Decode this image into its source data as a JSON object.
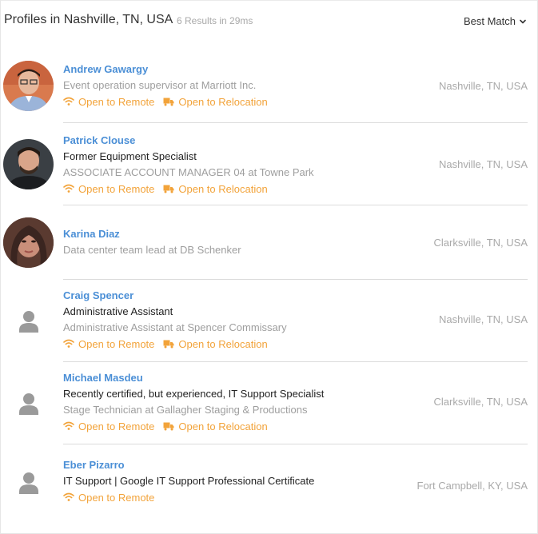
{
  "header": {
    "title": "Profiles in Nashville, TN, USA",
    "meta": "6 Results in 29ms",
    "sort_label": "Best Match"
  },
  "tags": {
    "remote": "Open to Remote",
    "relocation": "Open to Relocation"
  },
  "colors": {
    "accent": "#4b8fd6",
    "tag": "#f2a33a",
    "muted": "#9e9e9e"
  },
  "profiles": [
    {
      "name": "Andrew Gawargy",
      "headline": "",
      "subtitle": "Event operation supervisor at Marriott Inc.",
      "location": "Nashville, TN, USA"
    },
    {
      "name": "Patrick Clouse",
      "headline": "Former Equipment Specialist",
      "subtitle": "ASSOCIATE ACCOUNT MANAGER 04 at Towne Park",
      "location": "Nashville, TN, USA"
    },
    {
      "name": "Karina Diaz",
      "headline": "",
      "subtitle": "Data center team lead at DB Schenker",
      "location": "Clarksville, TN, USA"
    },
    {
      "name": "Craig Spencer",
      "headline": "Administrative Assistant",
      "subtitle": "Administrative Assistant at Spencer Commissary",
      "location": "Nashville, TN, USA"
    },
    {
      "name": "Michael Masdeu",
      "headline": "Recently certified, but experienced, IT Support Specialist",
      "subtitle": "Stage Technician at Gallagher Staging & Productions",
      "location": "Clarksville, TN, USA"
    },
    {
      "name": "Eber Pizarro",
      "headline": "IT Support | Google IT Support Professional Certificate",
      "subtitle": "",
      "location": "Fort Campbell, KY, USA"
    }
  ]
}
